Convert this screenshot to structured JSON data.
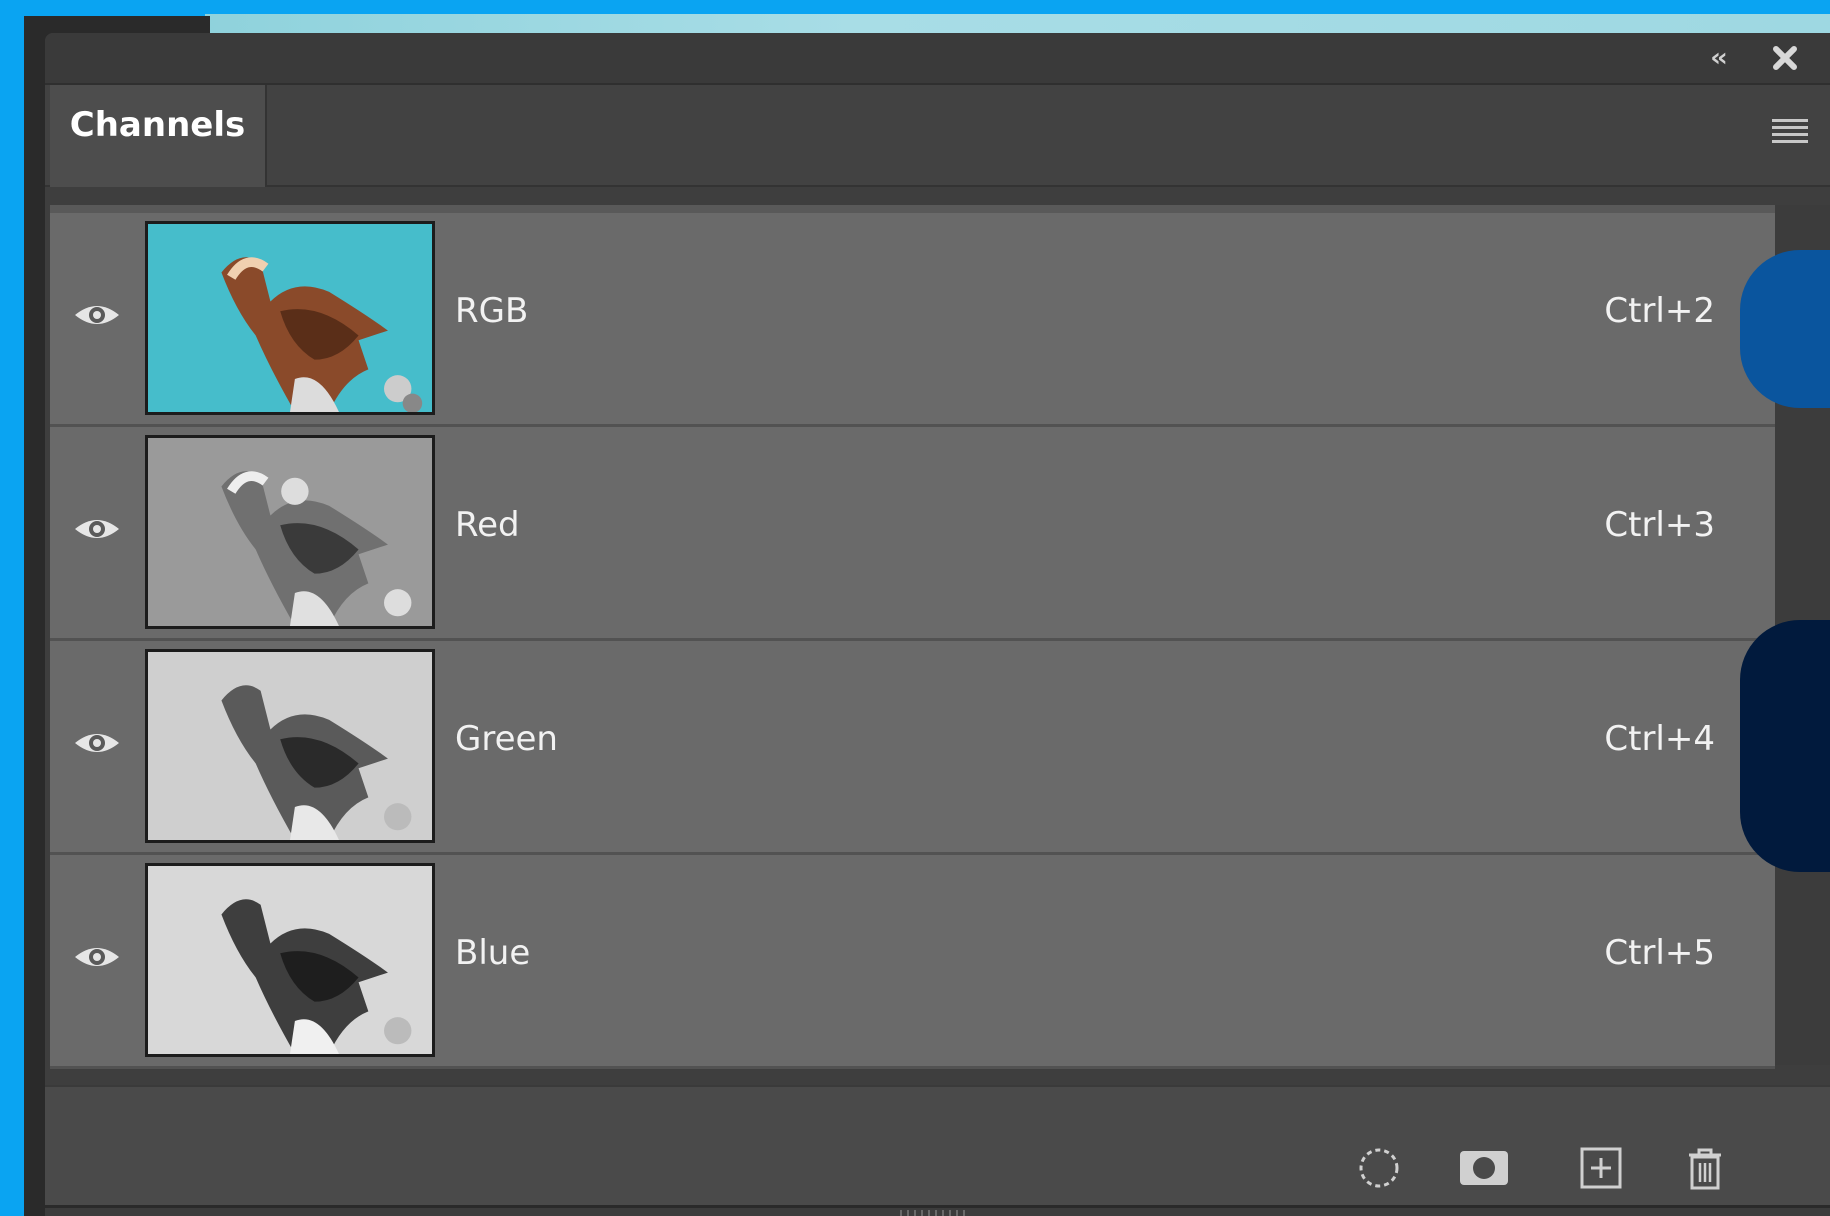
{
  "panel": {
    "tab_label": "Channels",
    "collapse_glyph": "‹‹",
    "icons": {
      "collapse": "double-chevron-left-icon",
      "close": "close-icon",
      "menu": "hamburger-menu-icon"
    }
  },
  "channels": [
    {
      "name": "RGB",
      "shortcut": "Ctrl+2",
      "visible": true,
      "thumbnail": "color"
    },
    {
      "name": "Red",
      "shortcut": "Ctrl+3",
      "visible": true,
      "thumbnail": "grayscale-light"
    },
    {
      "name": "Green",
      "shortcut": "Ctrl+4",
      "visible": true,
      "thumbnail": "grayscale"
    },
    {
      "name": "Blue",
      "shortcut": "Ctrl+5",
      "visible": true,
      "thumbnail": "grayscale-dark"
    }
  ],
  "footer": {
    "buttons": [
      {
        "icon": "load-selection-icon"
      },
      {
        "icon": "save-selection-as-channel-icon"
      },
      {
        "icon": "new-channel-icon"
      },
      {
        "icon": "delete-channel-icon"
      }
    ]
  },
  "colors": {
    "background_accent": "#0aa4f2",
    "panel": "#3e3e3e",
    "row": "#6a6a6a",
    "blob_blue": "#0a559e",
    "blob_navy": "#011a3d"
  }
}
